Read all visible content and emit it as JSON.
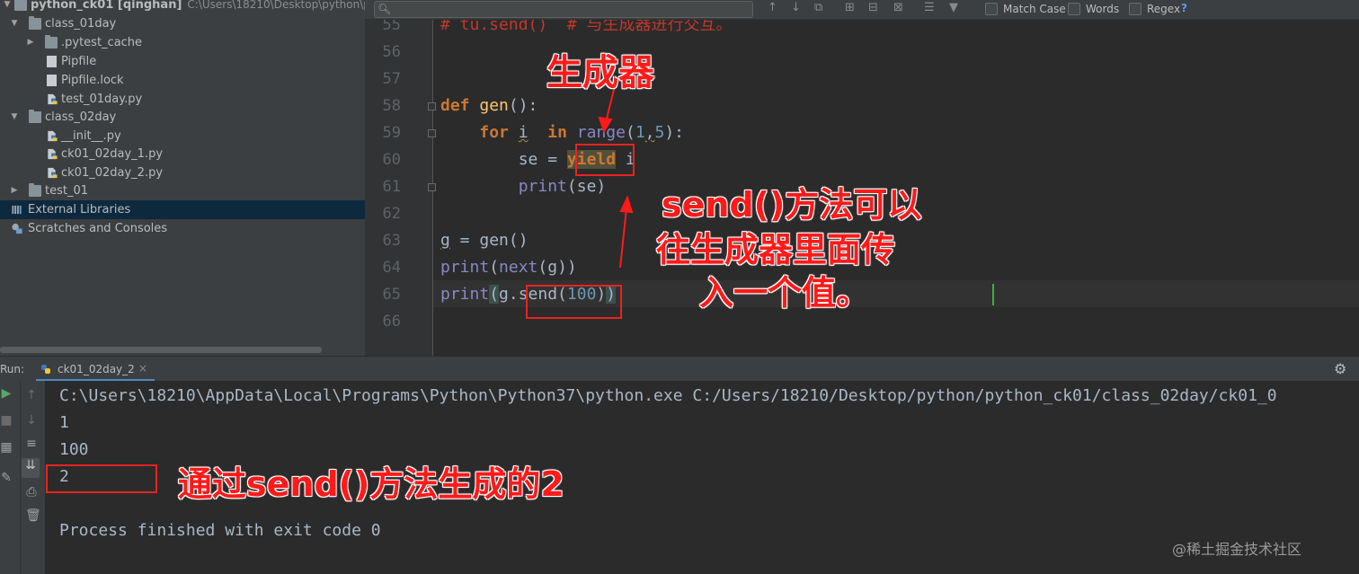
{
  "project_tree": {
    "root": {
      "label": "python_ck01 [qinghan]",
      "path": "C:\\Users\\18210\\Desktop\\python\\pyth"
    },
    "items": [
      {
        "label": "class_01day"
      },
      {
        "label": ".pytest_cache"
      },
      {
        "label": "Pipfile"
      },
      {
        "label": "Pipfile.lock"
      },
      {
        "label": "test_01day.py"
      },
      {
        "label": "class_02day"
      },
      {
        "label": "__init__.py"
      },
      {
        "label": "ck01_02day_1.py"
      },
      {
        "label": "ck01_02day_2.py"
      },
      {
        "label": "test_01"
      },
      {
        "label": "External Libraries"
      },
      {
        "label": "Scratches and Consoles"
      }
    ]
  },
  "find_bar": {
    "match_case": "Match Case",
    "words": "Words",
    "regex": "Regex",
    "help": "?"
  },
  "editor": {
    "line_numbers": [
      "55",
      "56",
      "57",
      "58",
      "59",
      "60",
      "61",
      "62",
      "63",
      "64",
      "65",
      "66"
    ],
    "l55_comment": "# tu.send()  # 与生成器进行交互。",
    "l58_def": "def",
    "l58_name": "gen",
    "l58_rest": "():",
    "l59_for": "for",
    "l59_var": "i",
    "l59_in": "in",
    "l59_range": "range",
    "l59_open": "(",
    "l59_n1": "1",
    "l59_comma": ",",
    "l59_n2": "5",
    "l59_close": "):",
    "l60_se": "se = ",
    "l60_yield": "yield",
    "l60_i": " i",
    "l61_print": "print",
    "l61_args": "(se)",
    "l63_g": "g",
    "l63_rest": " = gen()",
    "l64_print": "print",
    "l64_open": "(",
    "l64_next": "next",
    "l64_rest": "(g))",
    "l65_print": "print",
    "l65_open": "(",
    "l65_mid": "g.send(",
    "l65_num": "100",
    "l65_close1": ")",
    "l65_close2": ")"
  },
  "run_panel": {
    "label": "Run:",
    "tab_label": "ck01_02day_2",
    "tab_close": "×",
    "command": "C:\\Users\\18210\\AppData\\Local\\Programs\\Python\\Python37\\python.exe C:/Users/18210/Desktop/python/python_ck01/class_02day/ck01_0",
    "output_lines": [
      "1",
      "100",
      "2"
    ],
    "exit_message": "Process finished with exit code 0"
  },
  "annotations": {
    "generator": "生成器",
    "send_line1": "send()方法可以",
    "send_line2": "往生成器里面传",
    "send_line3": "入一个值。",
    "send_result": "通过send()方法生成的2"
  },
  "watermark": "@稀土掘金技术社区",
  "colors": {
    "editor_bg": "#2b2b2b",
    "panel_bg": "#3c3f41",
    "keyword": "#cc7832",
    "function": "#ffc66d",
    "builtin": "#8888c6",
    "number": "#6897bb",
    "annotation_red": "#e8231f"
  }
}
